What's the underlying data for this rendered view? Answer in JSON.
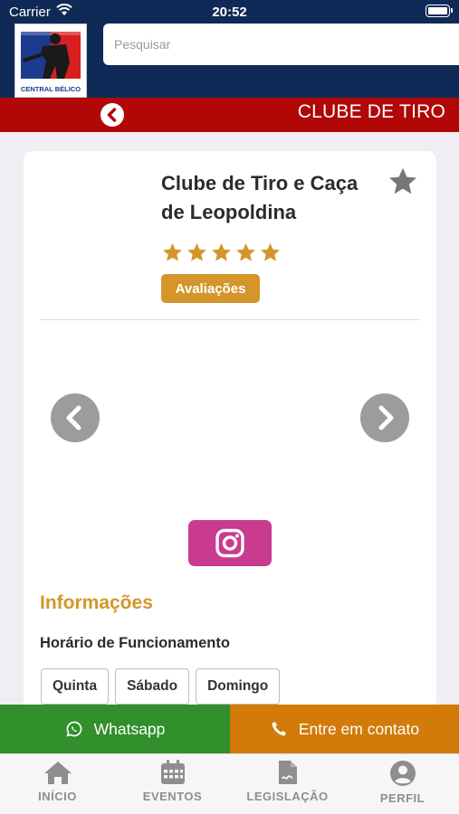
{
  "status_bar": {
    "carrier": "Carrier",
    "time": "20:52"
  },
  "header": {
    "logo_text": "CENTRAL BÉLICO",
    "search_placeholder": "Pesquisar",
    "section_title": "CLUBE DE TIRO"
  },
  "club": {
    "name_line1": "Clube de Tiro e Caça",
    "name_line2": "de Leopoldina",
    "rating": 5,
    "rating_max": 5,
    "reviews_label": "Avaliações"
  },
  "info": {
    "heading": "Informações",
    "hours_label": "Horário de Funcionamento",
    "days": [
      "Quinta",
      "Sábado",
      "Domingo"
    ]
  },
  "actions": {
    "whatsapp_label": "Whatsapp",
    "contact_label": "Entre em contato"
  },
  "tabs": [
    {
      "label": "INÍCIO",
      "icon": "home-icon"
    },
    {
      "label": "EVENTOS",
      "icon": "calendar-icon"
    },
    {
      "label": "LEGISLAÇÃO",
      "icon": "document-icon"
    },
    {
      "label": "PERFIL",
      "icon": "profile-icon"
    }
  ],
  "colors": {
    "header_bg": "#102a57",
    "section_bar": "#b10707",
    "accent_gold": "#d4962a",
    "whatsapp": "#318f2c",
    "contact": "#d27b09",
    "instagram": "#c93b8e"
  }
}
